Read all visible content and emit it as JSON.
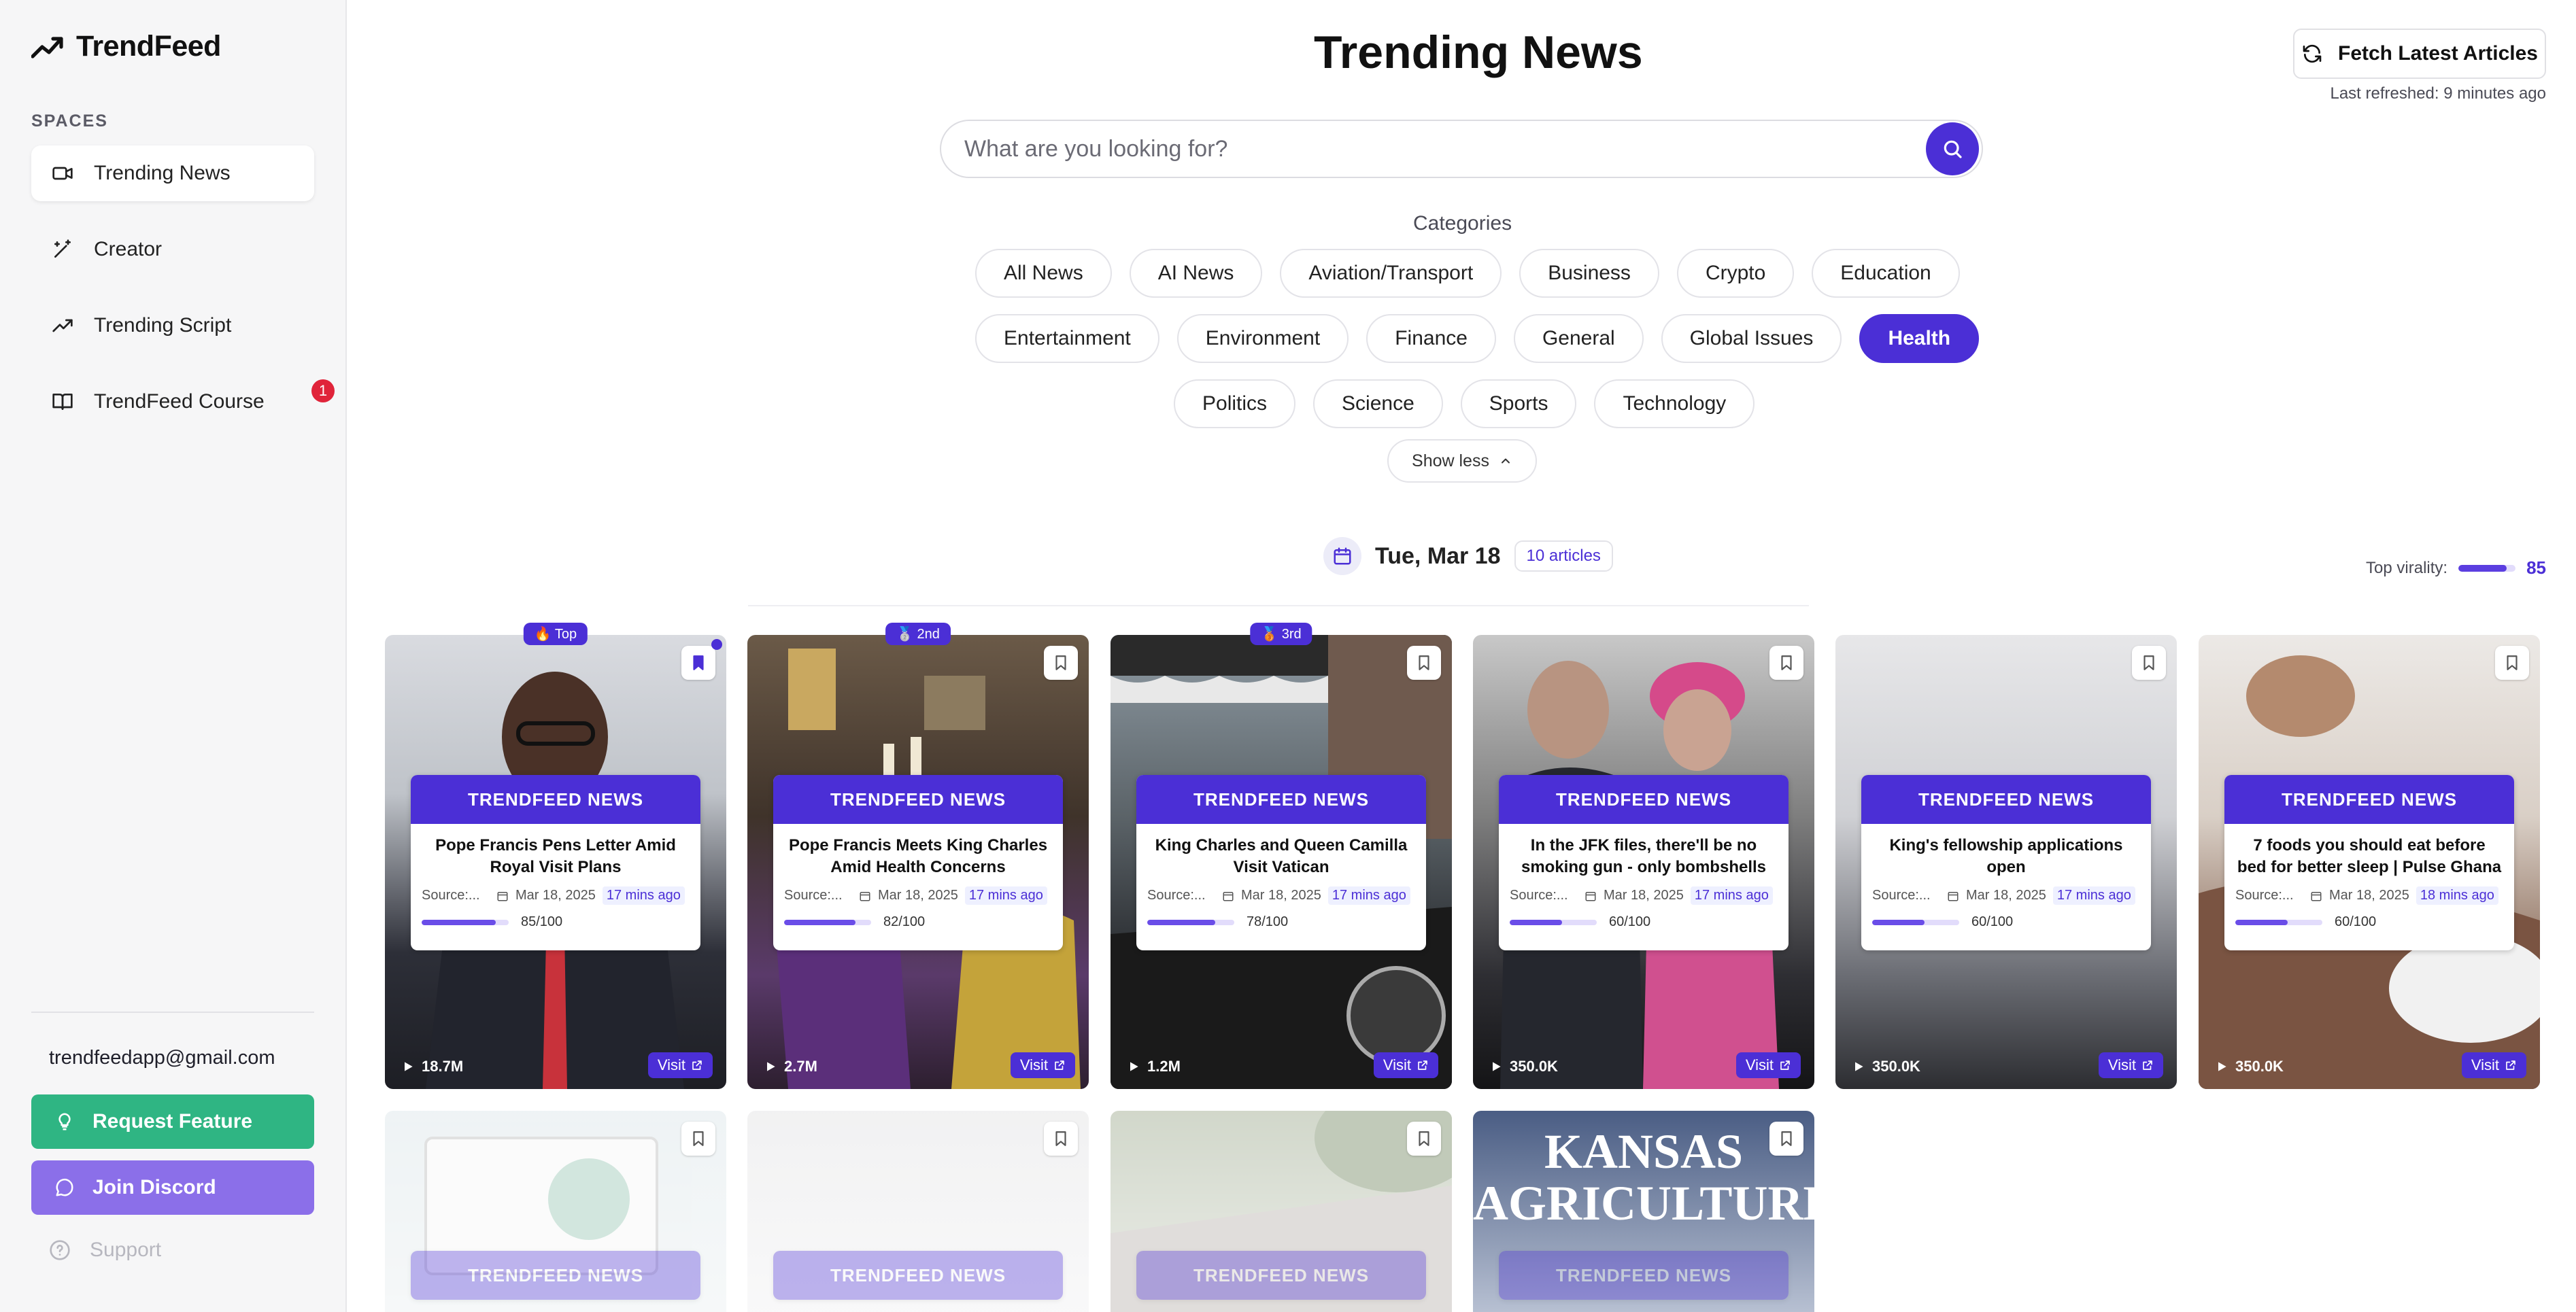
{
  "app": {
    "name": "TrendFeed"
  },
  "sidebar": {
    "section_label": "SPACES",
    "items": [
      {
        "label": "Trending News",
        "icon": "video-icon",
        "active": true
      },
      {
        "label": "Creator",
        "icon": "magic-wand-icon"
      },
      {
        "label": "Trending Script",
        "icon": "trending-up-icon"
      },
      {
        "label": "TrendFeed Course",
        "icon": "book-icon",
        "badge": "1"
      }
    ],
    "email": "trendfeedapp@gmail.com",
    "request_feature": "Request Feature",
    "join_discord": "Join Discord",
    "support": "Support"
  },
  "header": {
    "title": "Trending News",
    "fetch_button": "Fetch Latest Articles",
    "last_refreshed": "Last refreshed: 9 minutes ago"
  },
  "search": {
    "placeholder": "What are you looking for?"
  },
  "categories": {
    "label": "Categories",
    "row1": [
      "All News",
      "AI News",
      "Aviation/Transport",
      "Business",
      "Crypto",
      "Education"
    ],
    "row2": [
      "Entertainment",
      "Environment",
      "Finance",
      "General",
      "Global Issues",
      "Health"
    ],
    "row3": [
      "Politics",
      "Science",
      "Sports",
      "Technology"
    ],
    "active": "Health",
    "show_less": "Show less"
  },
  "date_group": {
    "date": "Tue, Mar 18",
    "count": "10 articles",
    "top_virality_label": "Top virality:",
    "top_virality_value": "85"
  },
  "colors": {
    "accent": "#4b2fd6",
    "request": "#2fb583",
    "discord": "#8b6fe9",
    "badge": "#e0243a"
  },
  "cards": [
    {
      "rank": "🔥 Top",
      "head": "TRENDFEED NEWS",
      "title": "Pope Francis Pens Letter Amid Royal Visit Plans",
      "source": "Source:...",
      "date": "Mar 18, 2025",
      "ago": "17 mins ago",
      "score": "85/100",
      "score_value": 85,
      "views": "18.7M",
      "visit": "Visit",
      "bookmarked": true
    },
    {
      "rank": "🥈 2nd",
      "head": "TRENDFEED NEWS",
      "title": "Pope Francis Meets King Charles Amid Health Concerns",
      "source": "Source:...",
      "date": "Mar 18, 2025",
      "ago": "17 mins ago",
      "score": "82/100",
      "score_value": 82,
      "views": "2.7M",
      "visit": "Visit"
    },
    {
      "rank": "🥉 3rd",
      "head": "TRENDFEED NEWS",
      "title": "King Charles and Queen Camilla Visit Vatican",
      "source": "Source:...",
      "date": "Mar 18, 2025",
      "ago": "17 mins ago",
      "score": "78/100",
      "score_value": 78,
      "views": "1.2M",
      "visit": "Visit"
    },
    {
      "head": "TRENDFEED NEWS",
      "title": "In the JFK files, there'll be no smoking gun - only bombshells",
      "source": "Source:...",
      "date": "Mar 18, 2025",
      "ago": "17 mins ago",
      "score": "60/100",
      "score_value": 60,
      "views": "350.0K",
      "visit": "Visit"
    },
    {
      "head": "TRENDFEED NEWS",
      "title": "King's fellowship applications open",
      "source": "Source:...",
      "date": "Mar 18, 2025",
      "ago": "17 mins ago",
      "score": "60/100",
      "score_value": 60,
      "views": "350.0K",
      "visit": "Visit"
    },
    {
      "head": "TRENDFEED NEWS",
      "title": "7 foods you should eat before bed for better sleep | Pulse Ghana",
      "source": "Source:...",
      "date": "Mar 18, 2025",
      "ago": "18 mins ago",
      "score": "60/100",
      "score_value": 60,
      "views": "350.0K",
      "visit": "Visit"
    }
  ],
  "cards_row2": [
    {
      "head": "TRENDFEED NEWS"
    },
    {
      "head": "TRENDFEED NEWS"
    },
    {
      "head": "TRENDFEED NEWS"
    },
    {
      "head": "TRENDFEED NEWS",
      "image_text": "KANSAS AGRICULTURE"
    }
  ]
}
